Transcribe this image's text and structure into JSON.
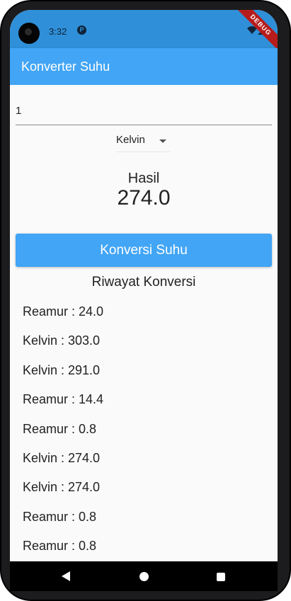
{
  "status_bar": {
    "time": "3:32",
    "notification_icon": "p-icon",
    "wifi_icon": "wifi-icon",
    "signal_icon": "signal-icon",
    "debug_banner": "DEBUG"
  },
  "app_bar": {
    "title": "Konverter Suhu"
  },
  "input": {
    "value": "1"
  },
  "dropdown": {
    "selected": "Kelvin",
    "icon": "caret-down-icon"
  },
  "result": {
    "label": "Hasil",
    "value": "274.0"
  },
  "convert_button": {
    "label": "Konversi Suhu"
  },
  "history": {
    "title": "Riwayat Konversi",
    "items": [
      "Reamur : 24.0",
      "Kelvin : 303.0",
      "Kelvin : 291.0",
      "Reamur : 14.4",
      "Reamur : 0.8",
      "Kelvin : 274.0",
      "Kelvin : 274.0",
      "Reamur : 0.8",
      "Reamur : 0.8"
    ]
  },
  "nav_bar": {
    "back_icon": "back-triangle-icon",
    "home_icon": "home-circle-icon",
    "recents_icon": "recents-square-icon"
  },
  "colors": {
    "primary": "#42a5f5",
    "status_bar": "#2f8fd8",
    "debug_ribbon": "#b71c1c",
    "background": "#fafafa"
  }
}
